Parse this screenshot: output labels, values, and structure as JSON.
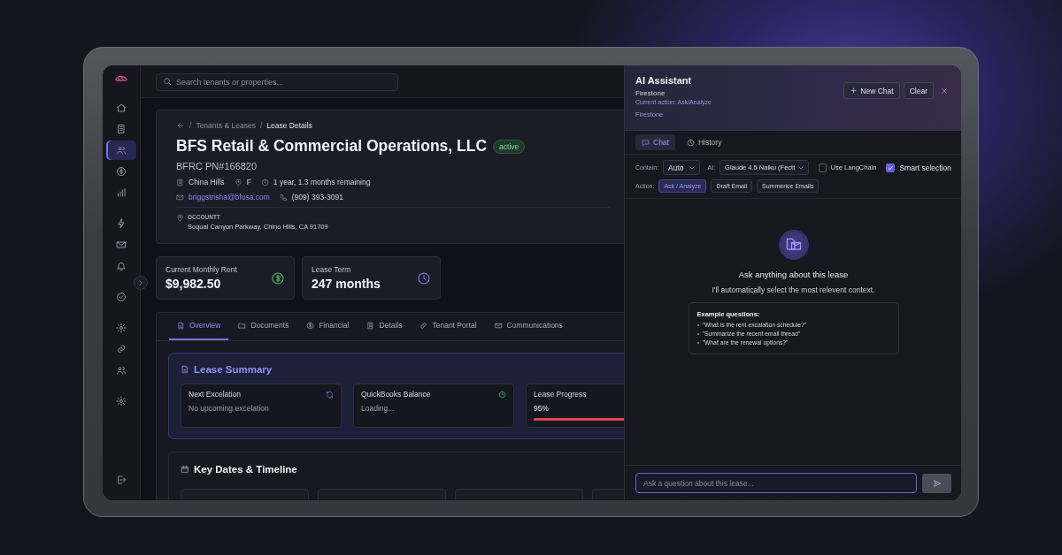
{
  "search": {
    "placeholder": "Search tenants or properties..."
  },
  "sidebar": {
    "items": [
      {
        "selected": false
      },
      {
        "selected": false
      },
      {
        "selected": true
      },
      {
        "selected": false
      },
      {
        "selected": false
      },
      {
        "selected": false
      },
      {
        "selected": false
      },
      {
        "selected": false
      },
      {
        "selected": false
      },
      {
        "selected": false
      },
      {
        "selected": false
      },
      {
        "selected": false
      },
      {
        "selected": false
      }
    ]
  },
  "breadcrumb": [
    "Tenants & Leases",
    "Lease Details"
  ],
  "breadcrumb_separator": "/",
  "lease": {
    "title": "BFS Retail & Commercial Operations, LLC",
    "status": "active",
    "subtitle": "BFRC PN#166820",
    "city": "China Hills",
    "unit": "F",
    "remaining": "1 year, 1.3 months remaining",
    "email": "briggstrisha@bfusa.com",
    "phone": "(909) 393-3091",
    "address_label": "OCCOUNTT",
    "address": "Soqual Canyon Parkway, Chino Hills, CA 91709"
  },
  "stats": [
    {
      "kind": "money",
      "label": "Current Monthly Rent",
      "value": "$9,982.50"
    },
    {
      "kind": "time",
      "label": "Lease Term",
      "value": "247 months"
    }
  ],
  "tabs": [
    {
      "label": "Overview",
      "selected": true
    },
    {
      "label": "Documents",
      "selected": false
    },
    {
      "label": "Financial",
      "selected": false
    },
    {
      "label": "Details",
      "selected": false
    },
    {
      "label": "Tenant Portal",
      "selected": false
    },
    {
      "label": "Communications",
      "selected": false
    }
  ],
  "lease_summary": {
    "title": "Lease Summary",
    "cards": [
      {
        "kind": "text",
        "label": "Next Excelation",
        "value": "No upcoming excelation"
      },
      {
        "kind": "loading",
        "label": "QuickBooks Balance",
        "value": "Loading..."
      },
      {
        "kind": "progress",
        "label": "Lease Progress",
        "value": "95%",
        "level": 0.95
      }
    ]
  },
  "timeline": {
    "title": "Key Dates & Timeline"
  },
  "assistant": {
    "title": "AI Assistant",
    "subtitle": "Firestone",
    "current_action": "Current action: Ask/Analyze",
    "context": "Firestone",
    "new_chat": "New Chat",
    "clear": "Clear",
    "tabs": [
      {
        "label": "Chat",
        "selected": true
      },
      {
        "label": "History",
        "selected": false
      }
    ],
    "context_label": "Contain:",
    "context_value": "Auto",
    "model_label": "AI:",
    "model_value": "Glaude 4.5 Naiku (Fectt",
    "use_langchain": {
      "label": "Use LangChain",
      "checked": false
    },
    "smart_selection": {
      "label": "Smart selection",
      "checked": true
    },
    "action_label": "Action:",
    "actions": [
      {
        "label": "Ask / Analyze",
        "selected": true
      },
      {
        "label": "Draft Email",
        "selected": false
      },
      {
        "label": "Summerice Emails",
        "selected": false
      }
    ],
    "empty_title": "Ask anything about this lease",
    "empty_text": "I'll automatically select the most relevent context.",
    "examples_title": "Example questions:",
    "examples": [
      "\"What is the rent excalation schedule?\"",
      "\"Summarize the recent email thread\"",
      "\"What are the renewal options?\""
    ],
    "input_placeholder": "Ask a question about this lease..."
  }
}
